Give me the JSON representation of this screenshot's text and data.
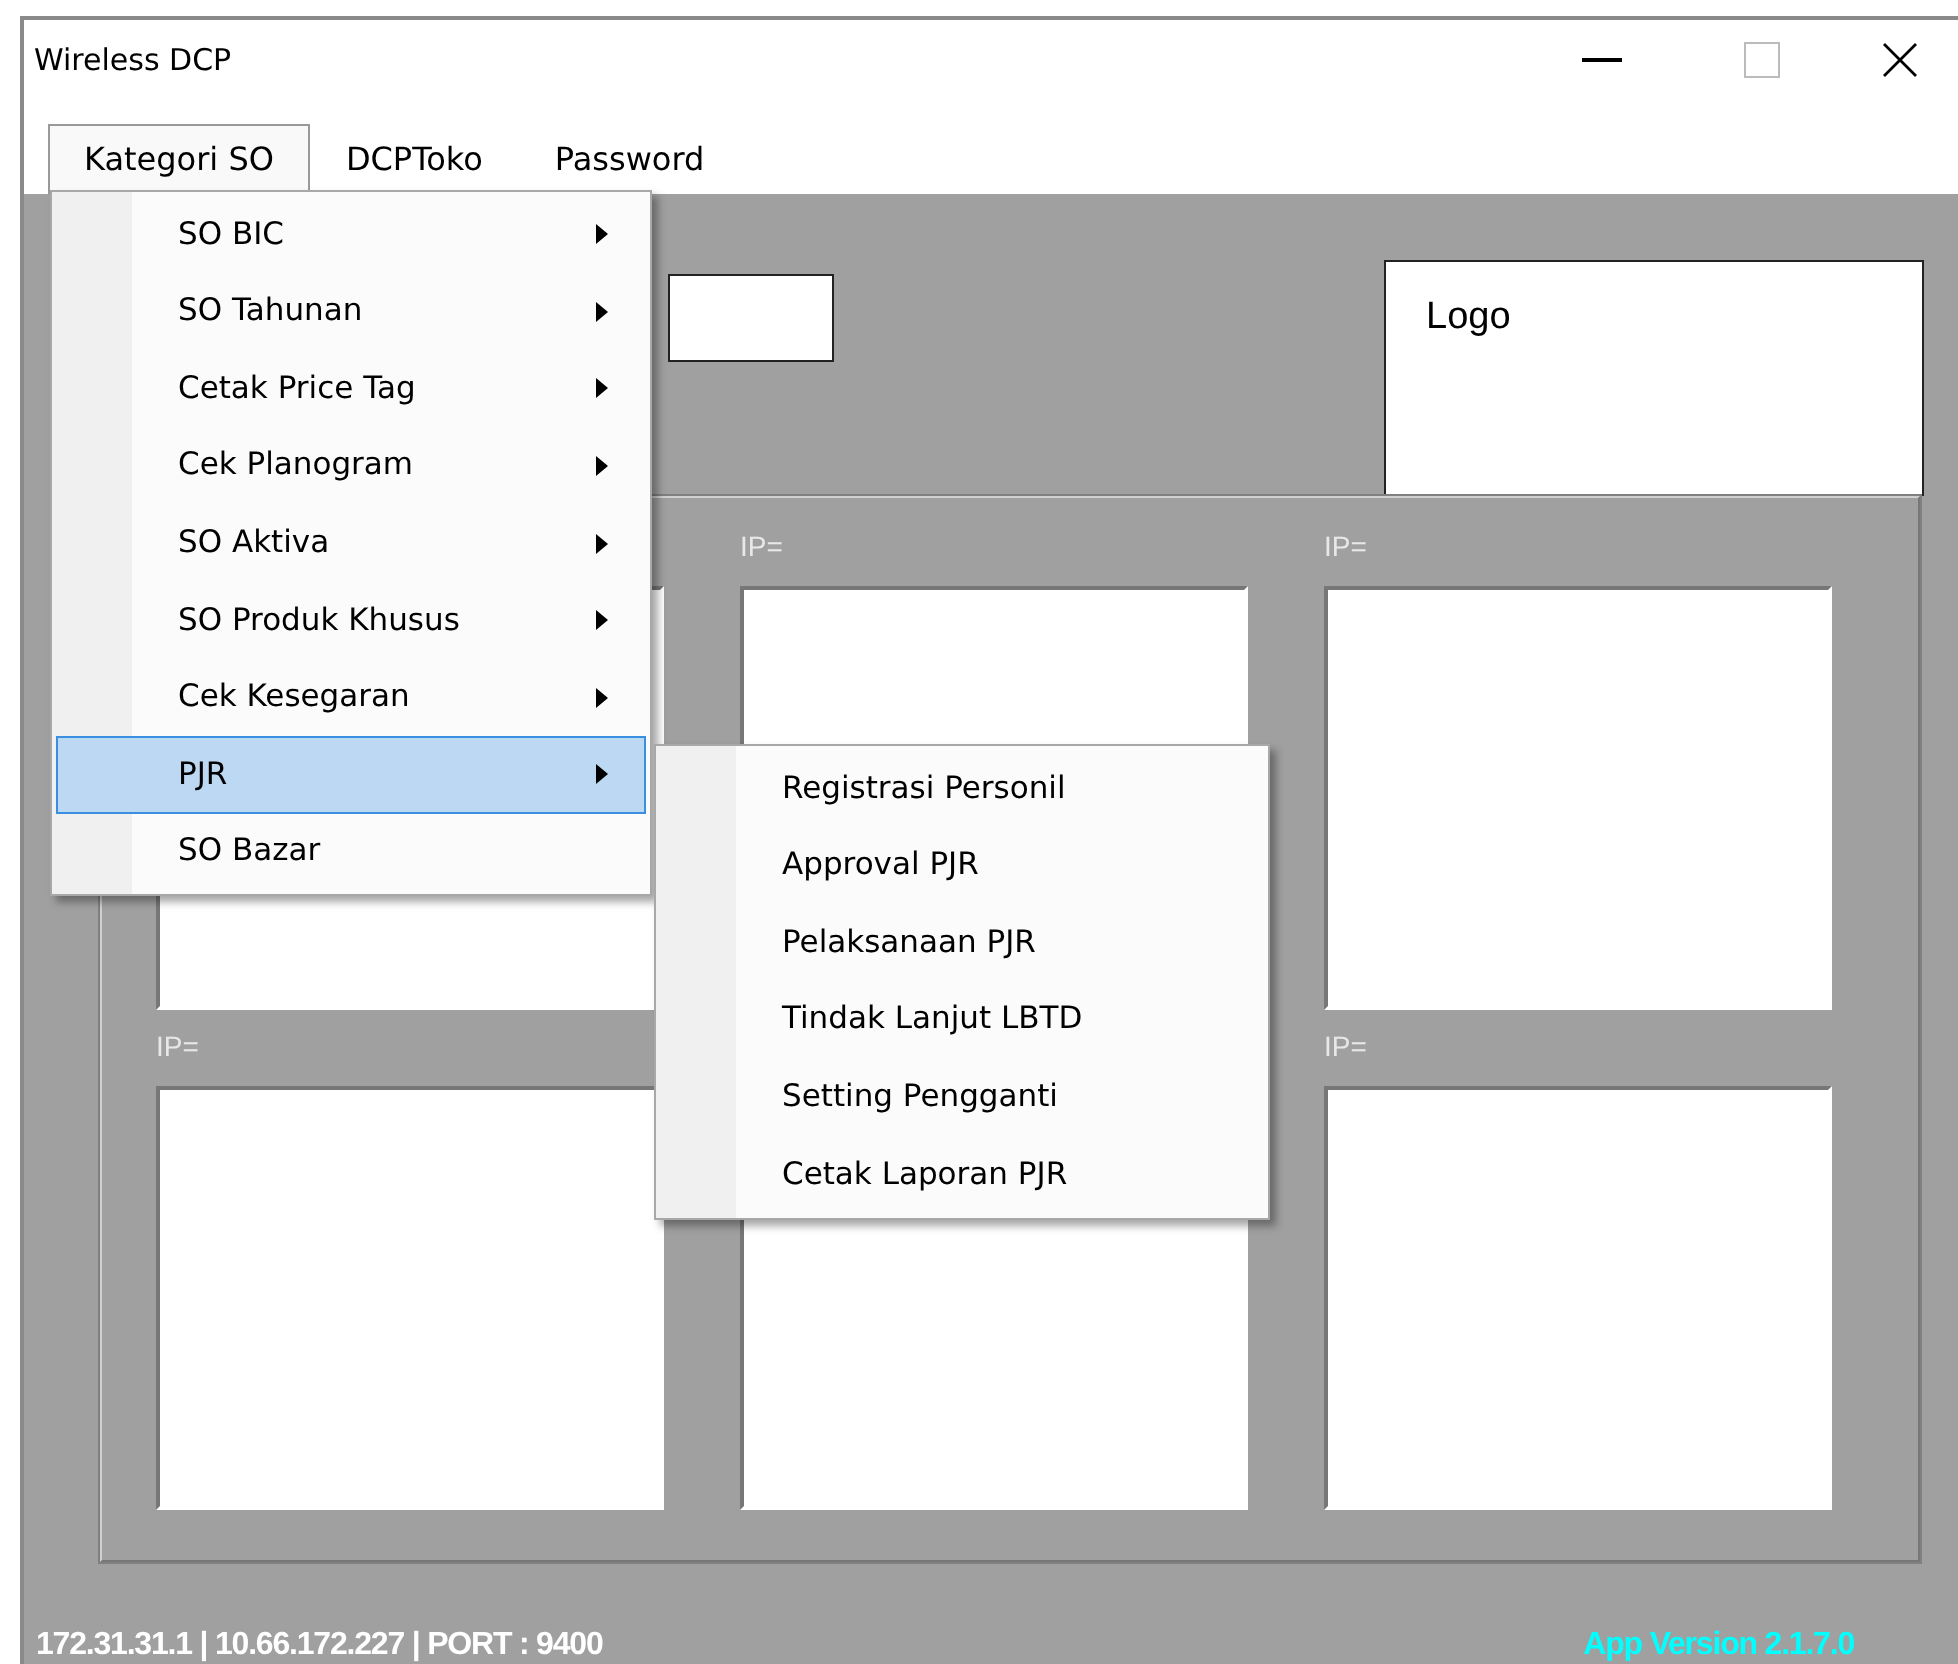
{
  "window": {
    "title": "Wireless DCP"
  },
  "menu_bar": [
    {
      "label": "Kategori SO",
      "selected": true
    },
    {
      "label": "DCPToko",
      "selected": false
    },
    {
      "label": "Password",
      "selected": false
    }
  ],
  "dropdown": {
    "items": [
      {
        "label": "SO BIC",
        "has_submenu": true,
        "selected": false
      },
      {
        "label": "SO Tahunan",
        "has_submenu": true,
        "selected": false
      },
      {
        "label": "Cetak Price Tag",
        "has_submenu": true,
        "selected": false
      },
      {
        "label": "Cek Planogram",
        "has_submenu": true,
        "selected": false
      },
      {
        "label": "SO Aktiva",
        "has_submenu": true,
        "selected": false
      },
      {
        "label": "SO Produk Khusus",
        "has_submenu": true,
        "selected": false
      },
      {
        "label": "Cek Kesegaran",
        "has_submenu": true,
        "selected": false
      },
      {
        "label": "PJR",
        "has_submenu": true,
        "selected": true
      },
      {
        "label": "SO Bazar",
        "has_submenu": false,
        "selected": false
      }
    ]
  },
  "submenu": {
    "items": [
      {
        "label": "Registrasi Personil"
      },
      {
        "label": "Approval PJR"
      },
      {
        "label": "Pelaksanaan PJR"
      },
      {
        "label": "Tindak Lanjut LBTD"
      },
      {
        "label": "Setting Pengganti"
      },
      {
        "label": "Cetak Laporan PJR"
      }
    ]
  },
  "logo_box": {
    "label": "Logo"
  },
  "panels": [
    {
      "kind": "unlabeled"
    },
    {
      "kind": "labeled",
      "label": "IP="
    },
    {
      "kind": "labeled",
      "label": "IP="
    },
    {
      "kind": "labeled",
      "label": "IP="
    },
    {
      "kind": "unlabeled"
    },
    {
      "kind": "labeled",
      "label": "IP="
    }
  ],
  "status_bar": {
    "connection": "172.31.31.1 | 10.66.172.227 | PORT : 9400",
    "version": "App Version 2.1.7.0"
  }
}
